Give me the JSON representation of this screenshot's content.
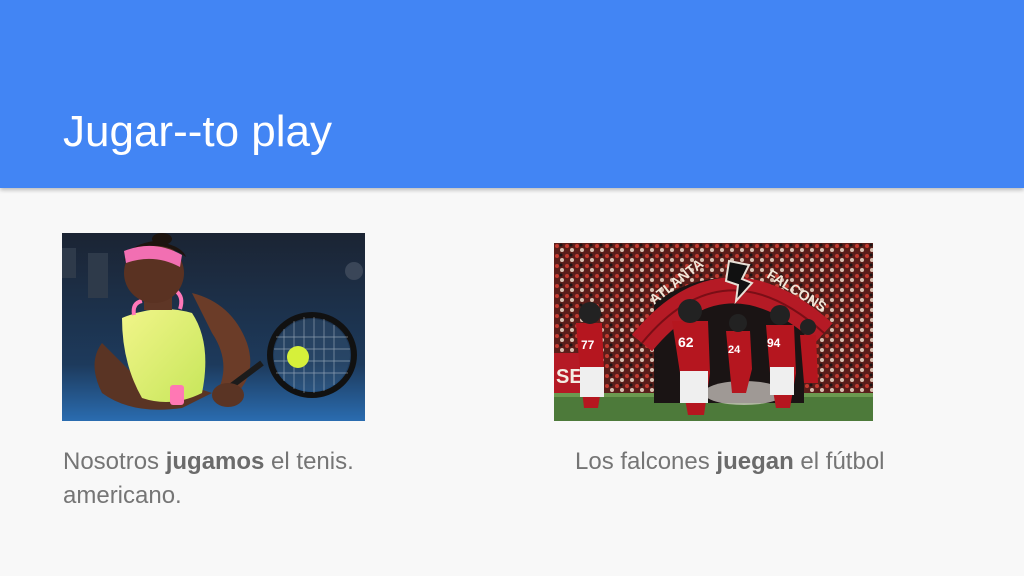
{
  "slide": {
    "title": "Jugar--to play",
    "colors": {
      "header_bg": "#4285f4",
      "body_bg": "#f8f8f8",
      "caption_text": "#757575"
    }
  },
  "left": {
    "image_name": "tennis-player-photo",
    "caption": {
      "before": "Nosotros ",
      "verb": "jugamos",
      "after": " el tenis.",
      "line2": "americano."
    }
  },
  "right": {
    "image_name": "atlanta-falcons-photo",
    "banner_left_text": "ATLANTA",
    "banner_right_text": "FALCONS",
    "jersey_numbers": [
      "77",
      "62",
      "24",
      "94"
    ],
    "side_banner": "SE",
    "caption": {
      "before": "Los falcones ",
      "verb": "juegan",
      "after": " el fútbol"
    }
  }
}
